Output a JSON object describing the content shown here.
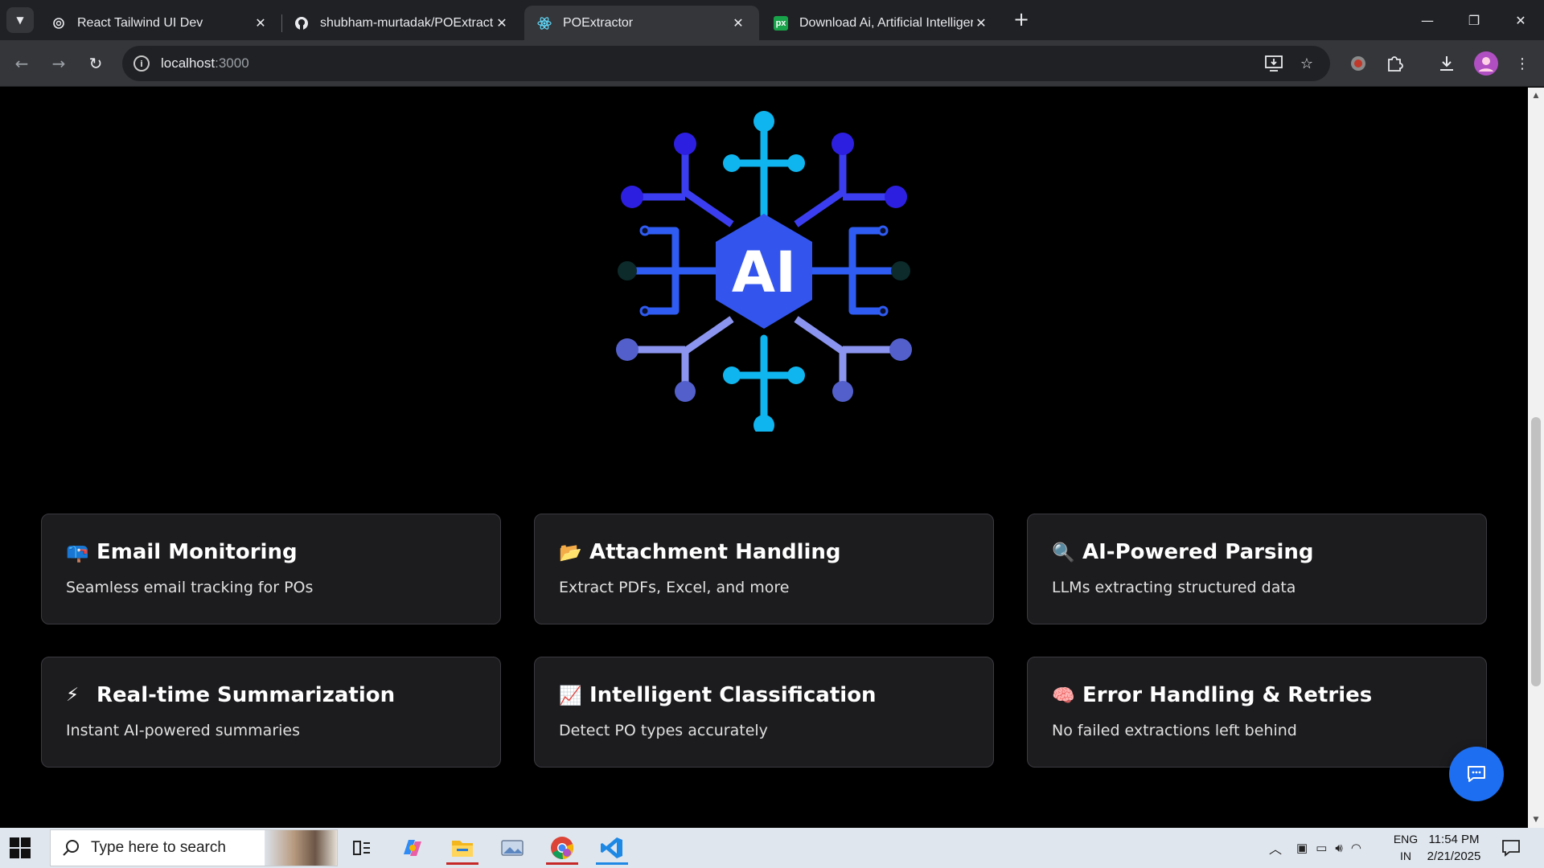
{
  "browser": {
    "tabs": [
      {
        "title": "React Tailwind UI Dev",
        "favicon": "openai-icon",
        "active": false
      },
      {
        "title": "shubham-murtadak/POExtracto",
        "favicon": "github-icon",
        "active": false
      },
      {
        "title": "POExtractor",
        "favicon": "react-icon",
        "active": true
      },
      {
        "title": "Download Ai, Artificial Intelliger",
        "favicon": "px-icon",
        "active": false
      }
    ],
    "address": {
      "host": "localhost",
      "port": ":3000"
    },
    "px_favicon_text": "px",
    "accent_color": "#1d6ef0"
  },
  "hero": {
    "logo_text": "AI"
  },
  "features": [
    {
      "emoji": "📪",
      "title": "Email Monitoring",
      "description": "Seamless email tracking for POs"
    },
    {
      "emoji": "📂",
      "title": "Attachment Handling",
      "description": "Extract PDFs, Excel, and more"
    },
    {
      "emoji": "🔍",
      "title": "AI-Powered Parsing",
      "description": "LLMs extracting structured data"
    },
    {
      "emoji": "⚡",
      "title": "Real-time Summarization",
      "description": "Instant AI-powered summaries"
    },
    {
      "emoji": "📈",
      "title": "Intelligent Classification",
      "description": "Detect PO types accurately"
    },
    {
      "emoji": "🧠",
      "title": "Error Handling & Retries",
      "description": "No failed extractions left behind"
    }
  ],
  "taskbar": {
    "search_placeholder": "Type here to search",
    "language": "ENG",
    "region": "IN",
    "time": "11:54 PM",
    "date": "2/21/2025"
  }
}
